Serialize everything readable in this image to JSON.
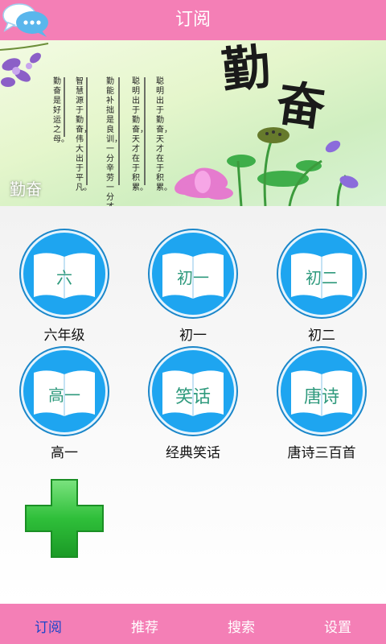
{
  "header": {
    "title": "订阅",
    "chat_icon": "chat-bubble-icon"
  },
  "banner": {
    "caption": "勤奋",
    "calligraphy": [
      "勤",
      "奋"
    ],
    "poem_lines": [
      "聪明出于勤奋，天才在于积累。",
      "勤能补拙是良训，一分辛劳一分才。",
      "智慧源于勤奋，伟大出于平凡。",
      "勤奋是好运之母。"
    ]
  },
  "subscriptions": [
    {
      "cover": "六",
      "label": "六年级"
    },
    {
      "cover": "初一",
      "label": "初一"
    },
    {
      "cover": "初二",
      "label": "初二"
    },
    {
      "cover": "高一",
      "label": "高一"
    },
    {
      "cover": "笑话",
      "label": "经典笑话"
    },
    {
      "cover": "唐诗",
      "label": "唐诗三百首"
    }
  ],
  "add_button": {
    "icon": "plus-icon"
  },
  "tabs": [
    {
      "label": "订阅",
      "active": true
    },
    {
      "label": "推荐",
      "active": false
    },
    {
      "label": "搜索",
      "active": false
    },
    {
      "label": "设置",
      "active": false
    }
  ],
  "colors": {
    "bar_pink": "#f47fb6",
    "circle_blue": "#1ea5f0",
    "active_tab": "#1b45c9",
    "plus_green": "#2fbf3a"
  }
}
